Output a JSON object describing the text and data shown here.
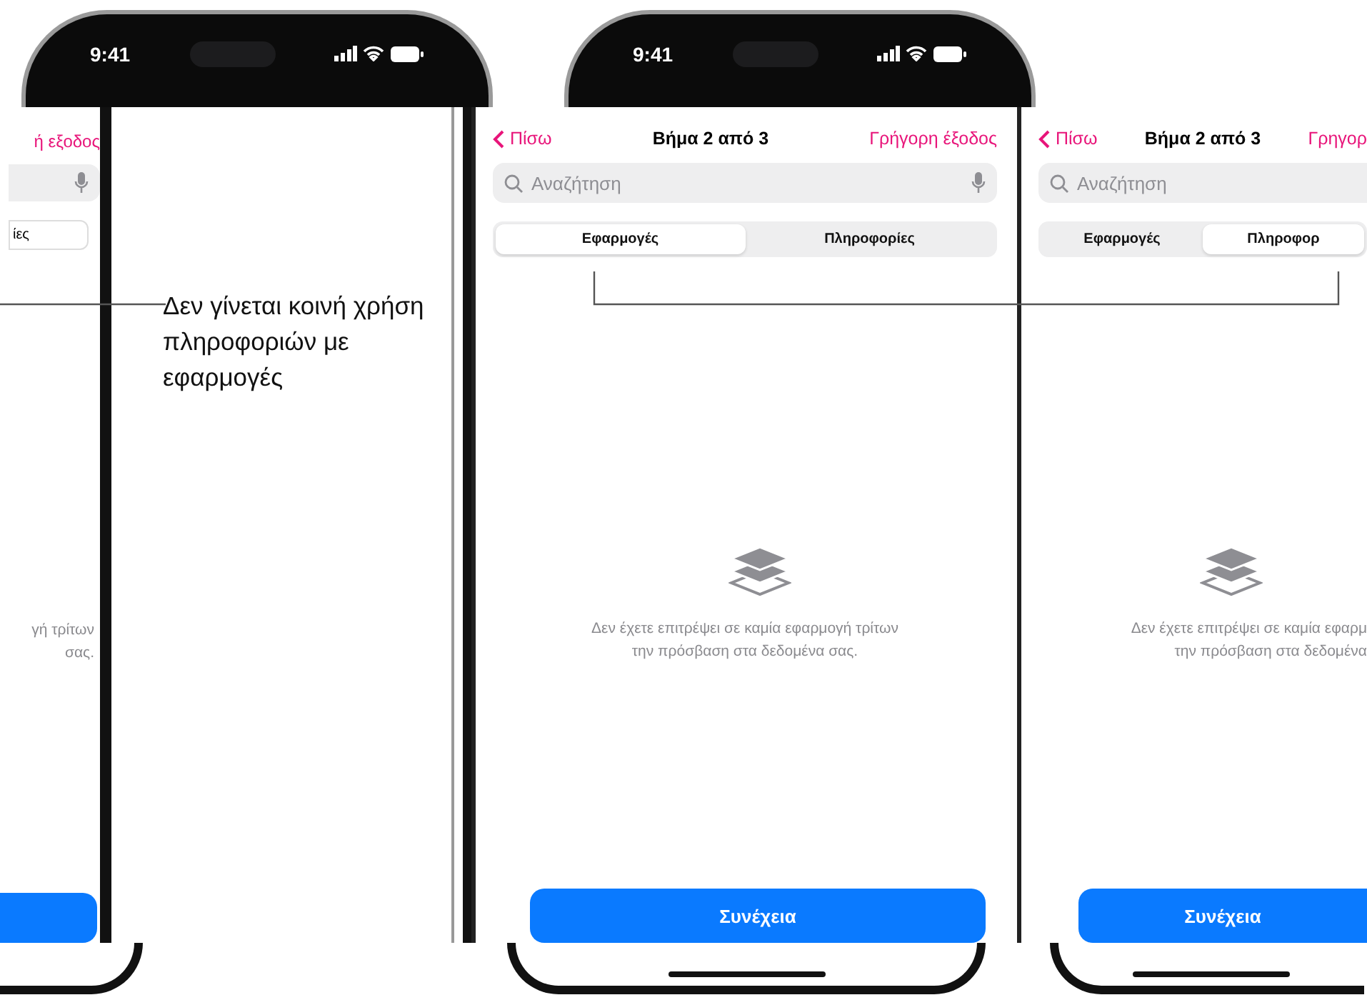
{
  "status_bars": [
    {
      "time": "9:41"
    },
    {
      "time": "9:41"
    }
  ],
  "left_phone": {
    "action": "ή εξοδος",
    "segment": "ίες",
    "message_lines": [
      "γή τρίτων",
      "σας."
    ]
  },
  "callout": "Δεν γίνεται κοινή χρήση πληροφοριών με εφαρμογές",
  "phones": [
    {
      "back": "Πίσω",
      "title": "Βήμα 2 από 3",
      "action": "Γρήγορη έξοδος",
      "search_placeholder": "Αναζήτηση",
      "segments": [
        {
          "label": "Εφαρμογές",
          "selected": true
        },
        {
          "label": "Πληροφορίες",
          "selected": false
        }
      ],
      "message_lines": [
        "Δεν έχετε επιτρέψει σε καμία εφαρμογή τρίτων",
        "την πρόσβαση στα δεδομένα σας."
      ],
      "button": "Συνέχεια"
    },
    {
      "back": "Πίσω",
      "title": "Βήμα 2 από 3",
      "action": "Γρηγορ",
      "search_placeholder": "Αναζήτηση",
      "segments": [
        {
          "label": "Εφαρμογές",
          "selected": false
        },
        {
          "label": "Πληροφορ",
          "selected": true
        }
      ],
      "message_lines": [
        "Δεν έχετε επιτρέψει σε καμία εφαρμ",
        "την πρόσβαση στα δεδομένα"
      ],
      "button": "Συνέχεια"
    }
  ]
}
